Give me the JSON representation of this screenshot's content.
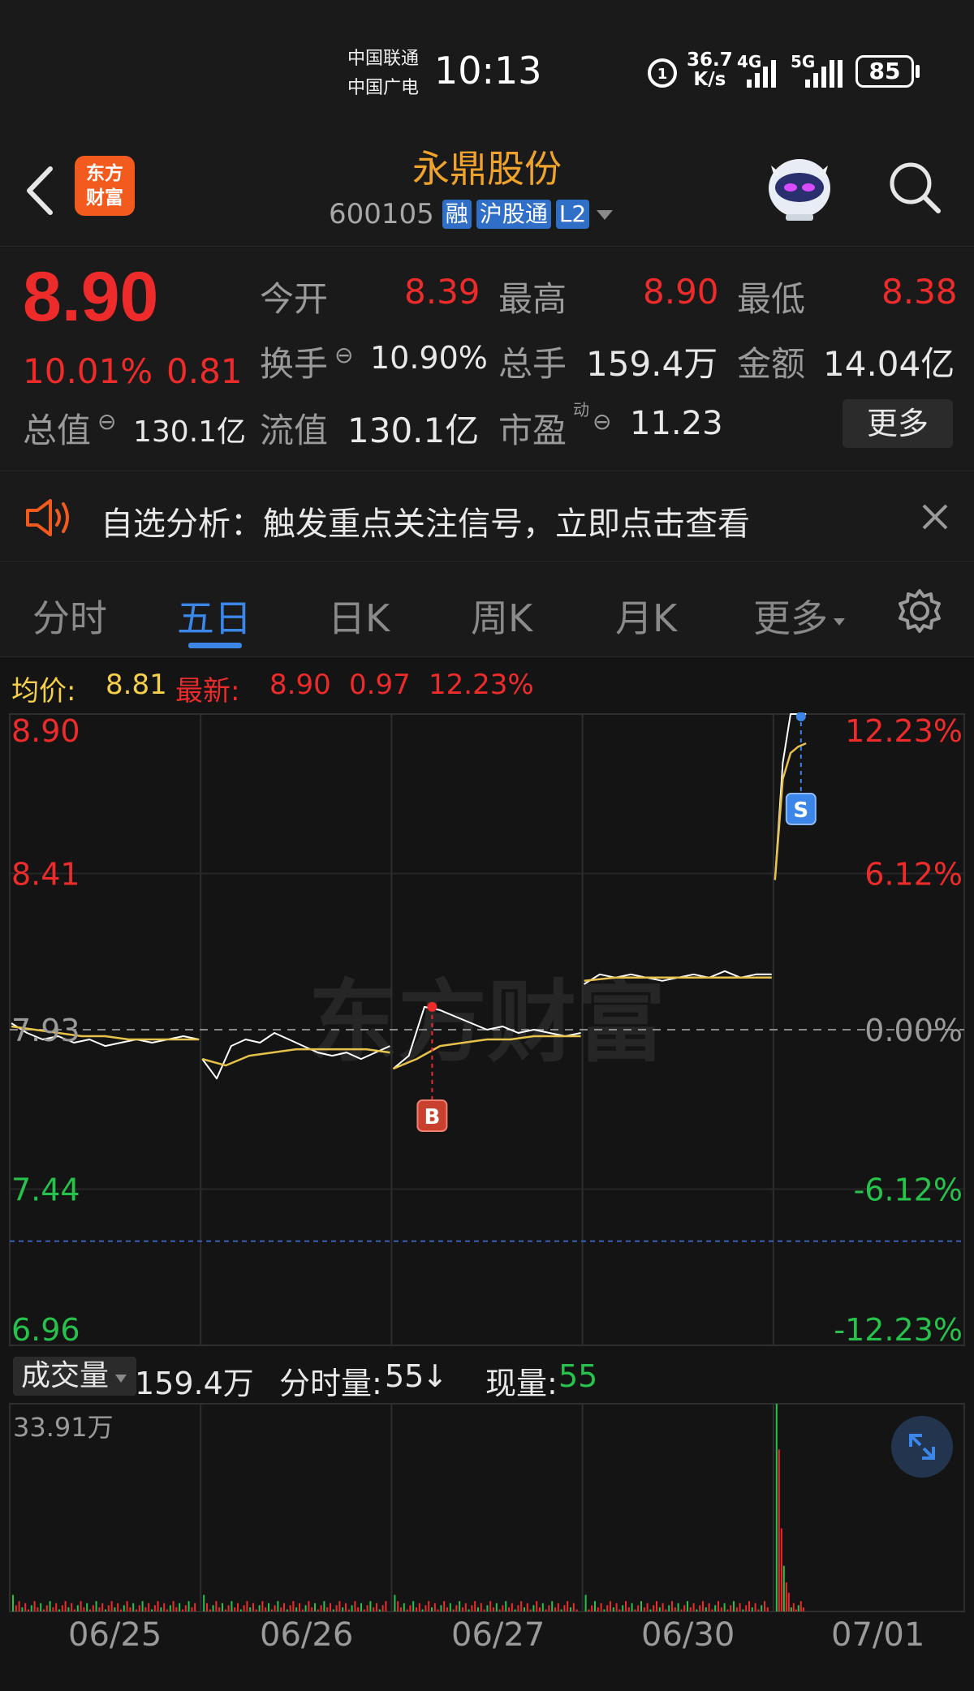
{
  "status_bar": {
    "carrier1": "中国联通",
    "carrier2": "中国广电",
    "time": "10:13",
    "net_speed_value": "36.7",
    "net_speed_unit": "K/s",
    "net1": "4G",
    "net2": "5G",
    "battery": "85"
  },
  "header": {
    "logo_line1": "东方",
    "logo_line2": "财富",
    "stock_name": "永鼎股份",
    "stock_code": "600105",
    "tags": [
      "融",
      "沪股通",
      "L2"
    ]
  },
  "quote": {
    "price": "8.90",
    "change_pct": "10.01%",
    "change": "0.81",
    "open_label": "今开",
    "open": "8.39",
    "high_label": "最高",
    "high": "8.90",
    "low_label": "最低",
    "low": "8.38",
    "turnover_label": "换手",
    "turnover": "10.90%",
    "volume_label": "总手",
    "volume": "159.4万",
    "amount_label": "金额",
    "amount": "14.04亿",
    "mktcap_label": "总值",
    "mktcap": "130.1亿",
    "float_label": "流值",
    "float": "130.1亿",
    "pe_label": "市盈",
    "pe_sup": "动",
    "pe": "11.23",
    "more_label": "更多"
  },
  "notice": {
    "text": "自选分析：触发重点关注信号，立即点击查看"
  },
  "tabs": [
    "分时",
    "五日",
    "日K",
    "周K",
    "月K",
    "更多"
  ],
  "legend": {
    "avg_label": "均价:",
    "avg_value": "8.81",
    "latest_label": "最新:",
    "latest_price": "8.90",
    "latest_change": "0.97",
    "latest_pct": "12.23%"
  },
  "chart_data": {
    "type": "line",
    "title": "",
    "y_left_ticks": [
      "8.90",
      "8.41",
      "7.93",
      "7.44",
      "6.96"
    ],
    "y_right_ticks": [
      "12.23%",
      "6.12%",
      "0.00%",
      "-6.12%",
      "-12.23%"
    ],
    "x_categories": [
      "06/25",
      "06/26",
      "06/27",
      "06/30",
      "07/01"
    ],
    "ylim": [
      6.96,
      8.9
    ],
    "prev_close": 7.93,
    "series": [],
    "price_by_day": [
      [
        7.95,
        7.92,
        7.9,
        7.91,
        7.89,
        7.9,
        7.88,
        7.89,
        7.9,
        7.89,
        7.9,
        7.91,
        7.9
      ],
      [
        7.84,
        7.78,
        7.88,
        7.9,
        7.89,
        7.92,
        7.9,
        7.88,
        7.86,
        7.85,
        7.86,
        7.84,
        7.86,
        7.88
      ],
      [
        7.81,
        7.85,
        8.0,
        7.99,
        7.97,
        7.95,
        7.93,
        7.94,
        7.92,
        7.93,
        7.92,
        7.91,
        7.92
      ],
      [
        8.07,
        8.1,
        8.09,
        8.1,
        8.09,
        8.08,
        8.09,
        8.1,
        8.09,
        8.11,
        8.09,
        8.1,
        8.1
      ],
      [
        8.39,
        8.75,
        8.9,
        8.9,
        8.9
      ]
    ],
    "avg_by_day": [
      [
        7.94,
        7.93,
        7.92,
        7.91,
        7.91,
        7.9,
        7.9,
        7.9,
        7.9
      ],
      [
        7.84,
        7.82,
        7.85,
        7.86,
        7.87,
        7.87,
        7.87,
        7.87,
        7.86
      ],
      [
        7.81,
        7.84,
        7.88,
        7.89,
        7.9,
        7.9,
        7.91,
        7.91,
        7.91
      ],
      [
        8.08,
        8.09,
        8.09,
        8.09,
        8.09,
        8.09,
        8.09
      ],
      [
        8.39,
        8.7,
        8.78,
        8.8,
        8.81
      ]
    ],
    "marker_buy_label": "B",
    "marker_sell_label": "S",
    "volume": {
      "selector_label": "成交量",
      "total": "159.4万",
      "minute_label": "分时量:",
      "minute_value": "55",
      "minute_arrow": "↓",
      "current_label": "现量:",
      "current_value": "55",
      "max_label": "33.91万"
    }
  },
  "colors": {
    "up": "#ee2b2b",
    "down": "#27c24c",
    "avg_line": "#e6c24a",
    "price_line": "#ffffff",
    "accent": "#3b86e8",
    "brand": "#f35a1e"
  },
  "watermark": "东方财富"
}
